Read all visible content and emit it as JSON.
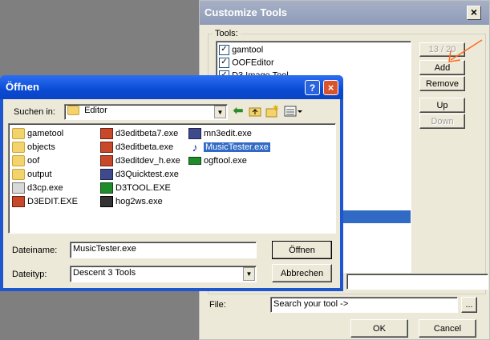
{
  "customize": {
    "title": "Customize Tools",
    "tools_label": "Tools:",
    "tools": [
      {
        "name": "gamtool",
        "checked": true
      },
      {
        "name": "OOFEditor",
        "checked": true
      },
      {
        "name": "D3 Image Tool",
        "checked": true
      }
    ],
    "counter": "13 / 20",
    "buttons": {
      "add": "Add",
      "remove": "Remove",
      "up": "Up",
      "down": "Down",
      "ok": "OK",
      "cancel": "Cancel",
      "browse": "..."
    },
    "file_label": "File:",
    "file_value": "Search your tool ->",
    "colors": {
      "title_inactive": "#96a2bd",
      "highlight": "#316ac5"
    }
  },
  "open_dialog": {
    "title": "Öffnen",
    "look_in_label": "Suchen in:",
    "look_in_value": "Editor",
    "files": [
      {
        "name": "gametool",
        "icon": "folder-icon"
      },
      {
        "name": "objects",
        "icon": "folder-icon"
      },
      {
        "name": "oof",
        "icon": "folder-icon"
      },
      {
        "name": "output",
        "icon": "folder-icon"
      },
      {
        "name": "d3cp.exe",
        "icon": "exe-icon"
      },
      {
        "name": "D3EDIT.EXE",
        "icon": "exe-icon"
      },
      {
        "name": "d3editbeta7.exe",
        "icon": "exe-icon"
      },
      {
        "name": "d3editbeta.exe",
        "icon": "exe-icon"
      },
      {
        "name": "d3editdev_h.exe",
        "icon": "exe-icon"
      },
      {
        "name": "d3Quicktest.exe",
        "icon": "exe-icon"
      },
      {
        "name": "D3TOOL.EXE",
        "icon": "exe-icon"
      },
      {
        "name": "hog2ws.exe",
        "icon": "exe-icon"
      },
      {
        "name": "mn3edit.exe",
        "icon": "exe-icon"
      },
      {
        "name": "MusicTester.exe",
        "icon": "music-note-icon",
        "selected": true
      },
      {
        "name": "ogftool.exe",
        "icon": "exe-icon"
      }
    ],
    "filename_label": "Dateiname:",
    "filename_value": "MusicTester.exe",
    "filetype_label": "Dateityp:",
    "filetype_value": "Descent 3 Tools",
    "open_button": "Öffnen",
    "cancel_button": "Abbrechen",
    "colors": {
      "title": "#0a4bd4",
      "selection": "#316ac5"
    }
  }
}
